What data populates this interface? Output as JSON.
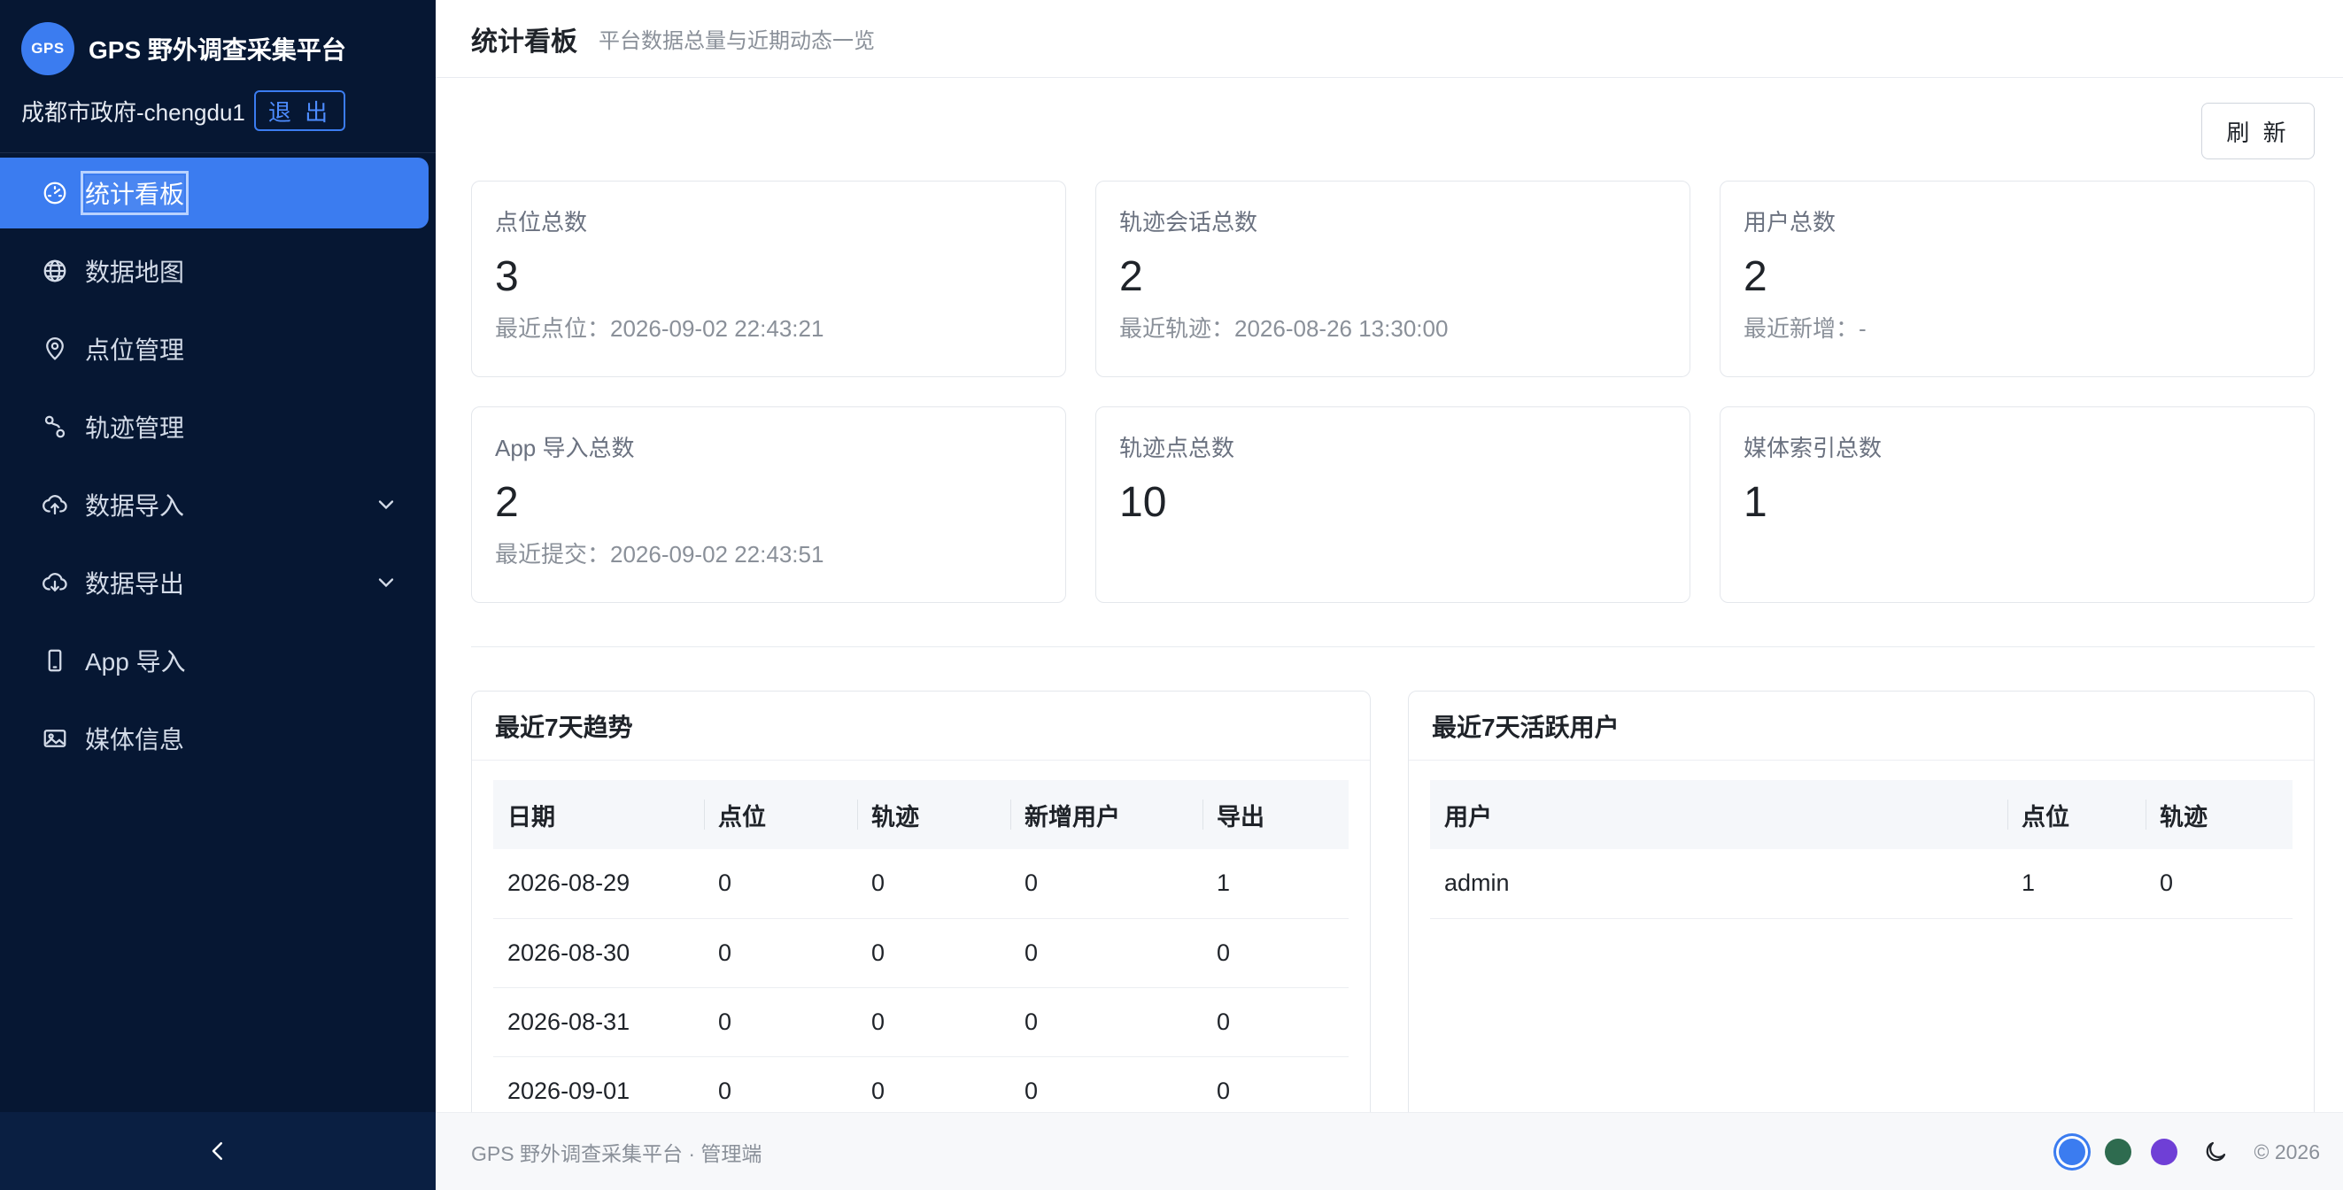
{
  "app": {
    "logo_text": "GPS",
    "title": "GPS 野外调查采集平台",
    "user": "成都市政府-chengdu1",
    "logout_label": "退 出"
  },
  "sidebar": {
    "items": [
      {
        "label": "统计看板",
        "icon": "dashboard-icon",
        "active": true
      },
      {
        "label": "数据地图",
        "icon": "globe-icon"
      },
      {
        "label": "点位管理",
        "icon": "location-pin-icon"
      },
      {
        "label": "轨迹管理",
        "icon": "route-icon"
      },
      {
        "label": "数据导入",
        "icon": "cloud-upload-icon",
        "expandable": true
      },
      {
        "label": "数据导出",
        "icon": "cloud-download-icon",
        "expandable": true
      },
      {
        "label": "App 导入",
        "icon": "mobile-icon"
      },
      {
        "label": "媒体信息",
        "icon": "image-icon"
      }
    ],
    "collapse_icon": "chevron-left-icon"
  },
  "header": {
    "title": "统计看板",
    "subtitle": "平台数据总量与近期动态一览",
    "refresh_label": "刷 新"
  },
  "stats": [
    {
      "label": "点位总数",
      "value": "3",
      "sub": "最近点位：2026-09-02 22:43:21"
    },
    {
      "label": "轨迹会话总数",
      "value": "2",
      "sub": "最近轨迹：2026-08-26 13:30:00"
    },
    {
      "label": "用户总数",
      "value": "2",
      "sub": "最近新增：-"
    },
    {
      "label": "App 导入总数",
      "value": "2",
      "sub": "最近提交：2026-09-02 22:43:51"
    },
    {
      "label": "轨迹点总数",
      "value": "10",
      "sub": ""
    },
    {
      "label": "媒体索引总数",
      "value": "1",
      "sub": ""
    }
  ],
  "trend": {
    "title": "最近7天趋势",
    "columns": [
      "日期",
      "点位",
      "轨迹",
      "新增用户",
      "导出"
    ],
    "rows": [
      [
        "2026-08-29",
        "0",
        "0",
        "0",
        "1"
      ],
      [
        "2026-08-30",
        "0",
        "0",
        "0",
        "0"
      ],
      [
        "2026-08-31",
        "0",
        "0",
        "0",
        "0"
      ],
      [
        "2026-09-01",
        "0",
        "0",
        "0",
        "0"
      ]
    ]
  },
  "active_users": {
    "title": "最近7天活跃用户",
    "columns": [
      "用户",
      "点位",
      "轨迹"
    ],
    "rows": [
      [
        "admin",
        "1",
        "0"
      ]
    ]
  },
  "footer": {
    "text": "GPS 野外调查采集平台 · 管理端",
    "theme_colors": [
      "#3b7cf0",
      "#2e6b4f",
      "#6f3fd6"
    ],
    "copyright": "© 2026"
  }
}
